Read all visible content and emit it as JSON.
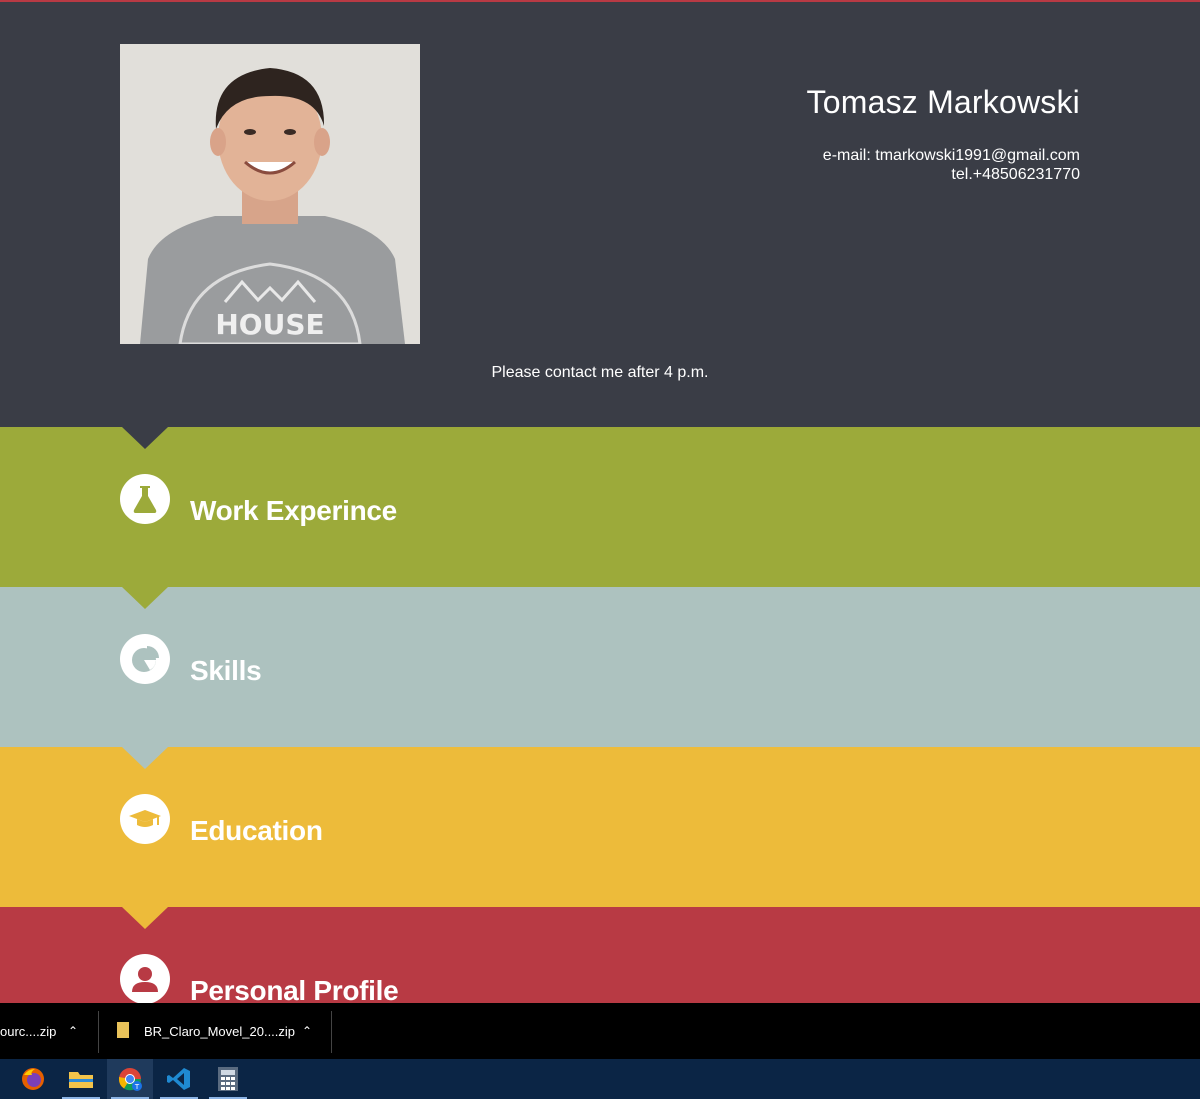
{
  "header": {
    "name": "Tomasz Markowski",
    "email_line": "e-mail: tmarkowski1991@gmail.com",
    "phone_line": "tel.+48506231770",
    "note": "Please contact me after 4 p.m.",
    "photo_shirt_text": "HOUSE",
    "bg_color": "#3a3d46"
  },
  "sections": [
    {
      "title": "Work Experince",
      "icon": "flask-icon",
      "color": "#9caa3a"
    },
    {
      "title": "Skills",
      "icon": "pie-chart-icon",
      "color": "#adc2bf"
    },
    {
      "title": "Education",
      "icon": "graduation-cap-icon",
      "color": "#edbb3a"
    },
    {
      "title": "Personal Profile",
      "icon": "user-icon",
      "color": "#b83a44"
    }
  ],
  "downloads": [
    {
      "label": "ourc....zip"
    },
    {
      "label": "BR_Claro_Movel_20....zip"
    }
  ],
  "taskbar": {
    "apps": [
      "firefox-icon",
      "file-explorer-icon",
      "chrome-icon",
      "vscode-icon",
      "calculator-icon"
    ],
    "active": "chrome-icon"
  }
}
